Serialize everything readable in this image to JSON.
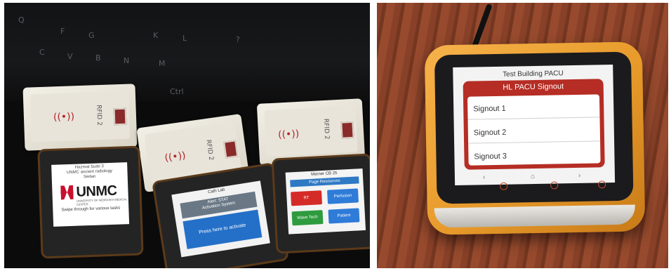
{
  "left_photo": {
    "keyboard_keys": [
      "Q",
      "F",
      "G",
      "K",
      "L",
      "?",
      "C",
      "V",
      "B",
      "N",
      "M",
      "Ctrl"
    ],
    "rfid_label": "RFID 2",
    "screen1": {
      "header_lines": [
        "Hazmat Suite 3",
        "UNMC ancient radiology",
        "Sedan"
      ],
      "logo_text": "UNMC",
      "logo_subtext": "UNIVERSITY OF NEBRASKA MEDICAL CENTER",
      "footer": "Swipe through for various tasks"
    },
    "screen2": {
      "title": "Cath Lab",
      "gray_lines": [
        "Alert: STAT",
        "Activation System"
      ],
      "blue_button": "Press here to activate"
    },
    "screen3": {
      "title": "Marner CB 25",
      "bar": "Page Resources",
      "buttons": [
        {
          "label": "RT",
          "color": "#d52b28"
        },
        {
          "label": "Perfusion",
          "color": "#2f7bd8"
        },
        {
          "label": "Wave Tech",
          "color": "#2e9b3e"
        },
        {
          "label": "Patient",
          "color": "#2f7bd8"
        }
      ]
    }
  },
  "right_photo": {
    "screen": {
      "title": "Test Building PACU",
      "header": "HL PACU Signout",
      "items": [
        "Signout 1",
        "Signout 2",
        "Signout 3"
      ]
    },
    "accent_color": "#f0a640"
  }
}
